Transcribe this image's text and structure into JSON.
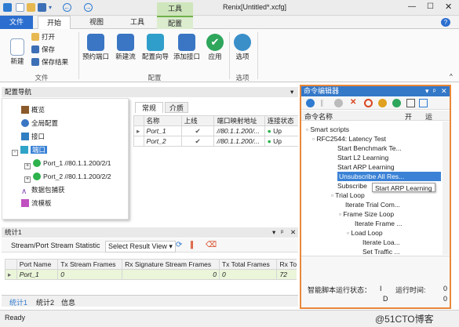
{
  "window": {
    "title": "Renix[Untitled*.xcfg]"
  },
  "ribbon": {
    "tabs": [
      "文件",
      "开始",
      "视图",
      "工具",
      "配置"
    ],
    "context_tab": "工具",
    "groups": {
      "file": {
        "label": "文件",
        "new": "新建",
        "open": "打开",
        "save": "保存",
        "save_result": "保存结果"
      },
      "config": {
        "label": "配置",
        "reserve_port": "预约端口",
        "new_stream": "新建流",
        "config_wizard": "配置向导",
        "add_interface": "添加接口",
        "apply": "应用"
      },
      "options": {
        "label": "选项",
        "options": "选项"
      }
    }
  },
  "nav": {
    "title": "配置导航",
    "items": [
      {
        "label": "概览",
        "icon": "home-icon"
      },
      {
        "label": "全局配置",
        "icon": "gear-icon"
      },
      {
        "label": "接口",
        "icon": "interface-icon"
      },
      {
        "label": "端口",
        "icon": "port-icon"
      },
      {
        "label": "Port_1 //80.1.1.200/2/1",
        "icon": "status-dot-icon"
      },
      {
        "label": "Port_2 //80.1.1.200/2/2",
        "icon": "status-dot-icon"
      },
      {
        "label": "数据包捕获",
        "icon": "capture-icon"
      },
      {
        "label": "流模板",
        "icon": "stream-template-icon"
      }
    ]
  },
  "ports": {
    "tabs": [
      "常规",
      "介质"
    ],
    "columns": [
      "名称",
      "上线",
      "端口映射地址",
      "连接状态"
    ],
    "rows": [
      {
        "name": "Port_1",
        "online": "✔",
        "address": "//80.1.1.200/...",
        "status": "Up"
      },
      {
        "name": "Port_2",
        "online": "✔",
        "address": "//80.1.1.200/...",
        "status": "Up"
      }
    ]
  },
  "stats": {
    "title": "统计1",
    "toolbar": {
      "label": "Stream/Port Stream Statistic",
      "view_select": "Select Result View"
    },
    "columns": [
      "Port Name",
      "Tx Stream Frames",
      "Rx Signature Stream Frames",
      "Tx Total Frames",
      "Rx Total F"
    ],
    "rows": [
      {
        "port": "Port_1",
        "tx_stream": "0",
        "rx_sig": "0",
        "tx_total": "0",
        "rx_total": "72"
      }
    ],
    "tabs": [
      "统计1",
      "统计2",
      "信息"
    ]
  },
  "cmd": {
    "title": "命令编辑器",
    "columns": [
      "命令名称",
      "开",
      "运"
    ],
    "tree": [
      {
        "label": "Smart scripts",
        "level": 0
      },
      {
        "label": "RFC2544: Latency Test",
        "level": 1
      },
      {
        "label": "Start Benchmark Te...",
        "level": 2
      },
      {
        "label": "Start L2 Learning",
        "level": 2
      },
      {
        "label": "Start ARP Learning",
        "level": 2
      },
      {
        "label": "Unsubscribe All Res...",
        "level": 2
      },
      {
        "label": "Subscribe",
        "level": 2
      },
      {
        "label": "Trial Loop",
        "level": 2
      },
      {
        "label": "Iterate Trial Com...",
        "level": 3
      },
      {
        "label": "Frame Size Loop",
        "level": 3
      },
      {
        "label": "Iterate Frame ...",
        "level": 4
      },
      {
        "label": "Load Loop",
        "level": 4
      },
      {
        "label": "Iterate Loa...",
        "level": 5
      },
      {
        "label": "Set Traffic ...",
        "level": 5
      }
    ],
    "tooltip": "Start ARP Learning",
    "status_label": "智能脚本运行状态：",
    "status_value": "I",
    "runtime_label": "运行时间:",
    "runtime_value": "0",
    "extra_d": "D",
    "extra_zero": "0"
  },
  "status": {
    "text": "Ready",
    "watermark": "@51CTO博客"
  }
}
